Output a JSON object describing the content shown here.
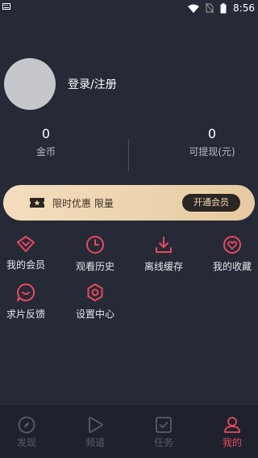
{
  "status_bar": {
    "left_icon": "keyboard-icon",
    "time": "8:56",
    "icons": [
      "wifi-icon",
      "no-sim-icon",
      "battery-icon"
    ]
  },
  "profile": {
    "login_label": "登录/注册"
  },
  "stats": {
    "coins_value": "0",
    "coins_label": "金币",
    "cash_value": "0",
    "cash_label": "可提现(元)"
  },
  "vip_banner": {
    "text": "限时优惠 限量",
    "button_label": "开通会员",
    "icon": "ticket-icon"
  },
  "grid": [
    {
      "label": "我的会员",
      "icon": "vip-diamond-icon"
    },
    {
      "label": "观看历史",
      "icon": "clock-icon"
    },
    {
      "label": "离线缓存",
      "icon": "download-icon"
    },
    {
      "label": "我的收藏",
      "icon": "heart-icon"
    },
    {
      "label": "求片反馈",
      "icon": "feedback-icon"
    },
    {
      "label": "设置中心",
      "icon": "settings-icon"
    }
  ],
  "bottom_nav": [
    {
      "label": "发现",
      "icon": "compass-icon",
      "active": false
    },
    {
      "label": "频道",
      "icon": "play-icon",
      "active": false
    },
    {
      "label": "任务",
      "icon": "task-icon",
      "active": false
    },
    {
      "label": "我的",
      "icon": "user-icon",
      "active": true
    }
  ],
  "colors": {
    "background": "#262a36",
    "accent": "#e8495f",
    "vip_gold": "#f3ddbd"
  }
}
